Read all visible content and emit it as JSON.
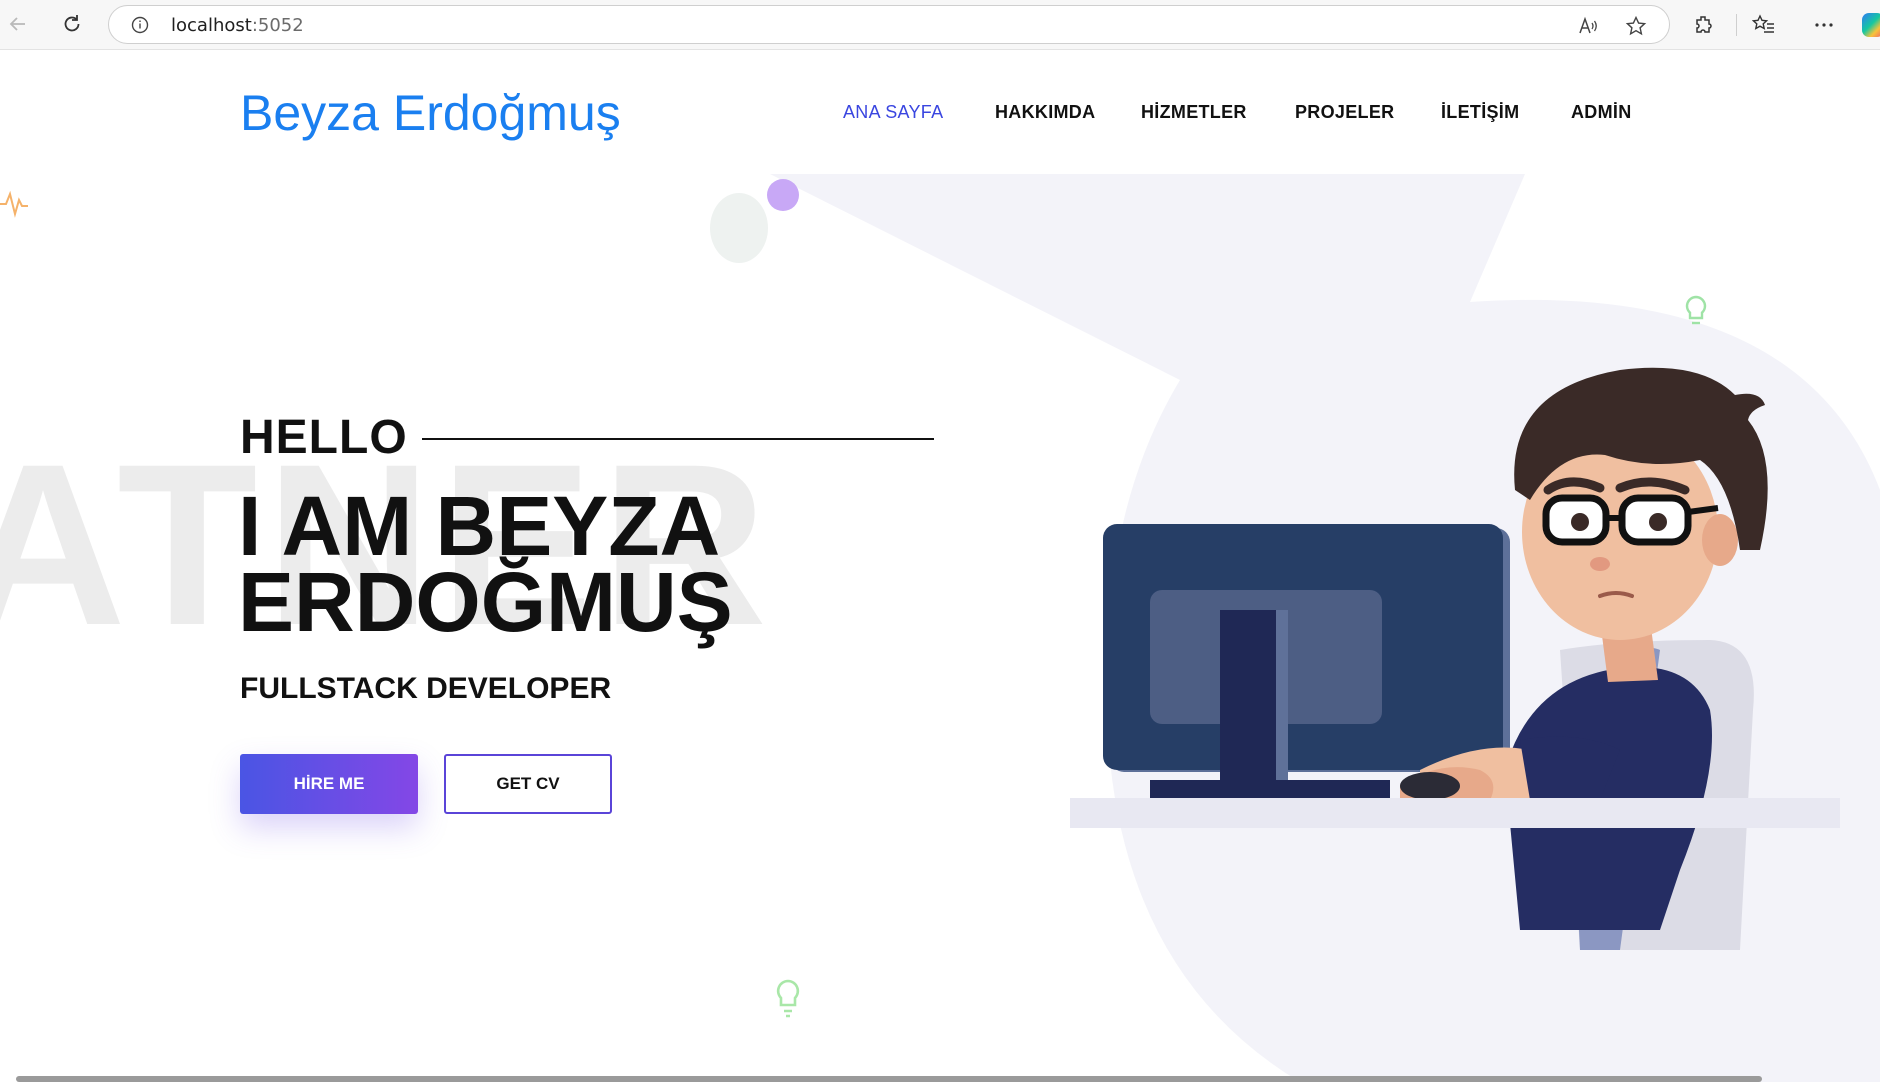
{
  "browser": {
    "url_host": "localhost",
    "url_port": ":5052"
  },
  "header": {
    "brand": "Beyza Erdoğmuş",
    "menu": [
      "ANA SAYFA",
      "HAKKIMDA",
      "HİZMETLER",
      "PROJELER",
      "İLETİŞİM",
      "ADMİN"
    ],
    "active_index": 0
  },
  "hero": {
    "hello": "HELLO",
    "headline_line1": "I AM BEYZA",
    "headline_line2": "ERDOĞMUŞ",
    "subtitle": "FULLSTACK DEVELOPER",
    "hire_button": "HİRE ME",
    "cv_button": "GET CV",
    "background_text": "ATNER"
  },
  "colors": {
    "brand": "#1a7ff0",
    "active_menu": "#3a46e0",
    "button_gradient_start": "#4a55e4",
    "button_gradient_end": "#8447e6"
  },
  "icons": [
    "back-arrow-icon",
    "refresh-icon",
    "info-icon",
    "read-aloud-icon",
    "favorite-star-icon",
    "extensions-icon",
    "favorites-list-icon",
    "more-icon",
    "copilot-icon"
  ]
}
